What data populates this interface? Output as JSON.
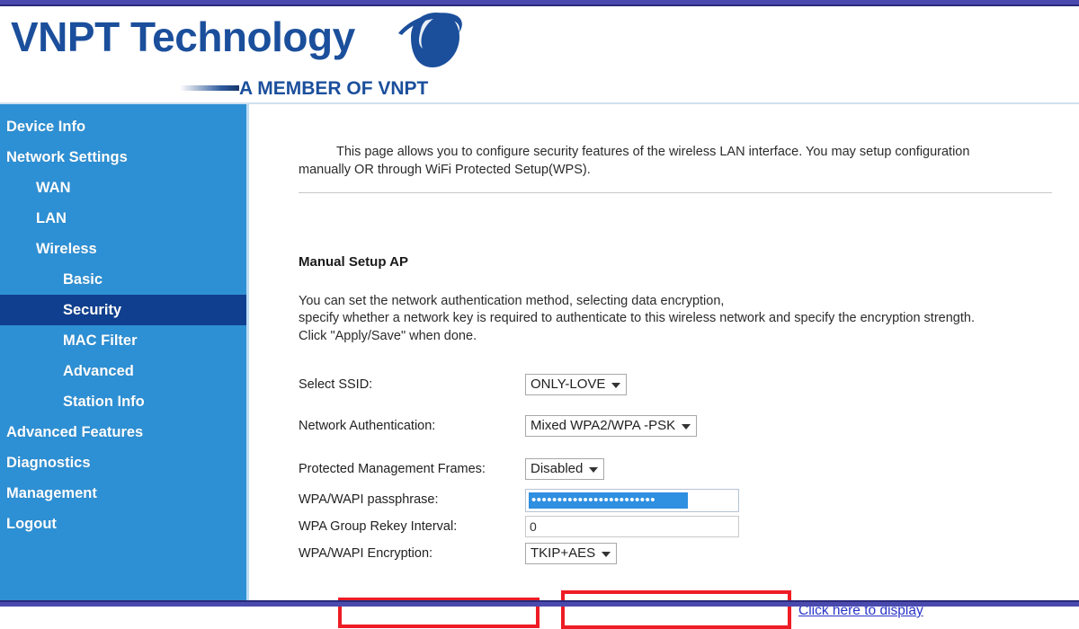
{
  "brand": {
    "title": "VNPT Technology",
    "subtitle": "A MEMBER OF VNPT",
    "logo_icon": "vnpt-globe-swoosh-icon",
    "primary_color": "#1b4f9c",
    "sidebar_color": "#2e90d4",
    "sidebar_active_color": "#103f8f",
    "chrome_bar_color": "#4a4aae",
    "annotation_color": "#ee1c25",
    "link_color": "#2a35c7"
  },
  "sidebar": {
    "items": [
      {
        "label": "Device Info",
        "level": 0,
        "active": false
      },
      {
        "label": "Network Settings",
        "level": 0,
        "active": false
      },
      {
        "label": "WAN",
        "level": 1,
        "active": false
      },
      {
        "label": "LAN",
        "level": 1,
        "active": false
      },
      {
        "label": "Wireless",
        "level": 1,
        "active": false
      },
      {
        "label": "Basic",
        "level": 2,
        "active": false
      },
      {
        "label": "Security",
        "level": 2,
        "active": true
      },
      {
        "label": "MAC Filter",
        "level": 2,
        "active": false
      },
      {
        "label": "Advanced",
        "level": 2,
        "active": false
      },
      {
        "label": "Station Info",
        "level": 2,
        "active": false
      },
      {
        "label": "Advanced Features",
        "level": 0,
        "active": false
      },
      {
        "label": "Diagnostics",
        "level": 0,
        "active": false
      },
      {
        "label": "Management",
        "level": 0,
        "active": false
      },
      {
        "label": "Logout",
        "level": 0,
        "active": false
      }
    ]
  },
  "main": {
    "intro": "This page allows you to configure security features of the wireless LAN interface. You may setup configuration manually OR through WiFi Protected Setup(WPS).",
    "section_title": "Manual Setup AP",
    "section_description": "You can set the network authentication method, selecting data encryption,\nspecify whether a network key is required to authenticate to this wireless network and specify the encryption strength.\nClick \"Apply/Save\" when done.",
    "fields": {
      "select_ssid": {
        "label": "Select SSID:",
        "value": "ONLY-LOVE",
        "options": [
          "ONLY-LOVE"
        ]
      },
      "network_authentication": {
        "label": "Network Authentication:",
        "value": "Mixed WPA2/WPA -PSK",
        "options": [
          "Mixed WPA2/WPA -PSK"
        ]
      },
      "protected_management_frames": {
        "label": "Protected Management Frames:",
        "value": "Disabled",
        "options": [
          "Disabled"
        ]
      },
      "wpa_passphrase": {
        "label": "WPA/WAPI passphrase:",
        "value": "••••••••••••••••••••••••",
        "masked": true,
        "selected": true,
        "reveal_link": "Click here to display"
      },
      "wpa_group_rekey_interval": {
        "label": "WPA Group Rekey Interval:",
        "value": "0"
      },
      "wpa_encryption": {
        "label": "WPA/WAPI Encryption:",
        "value": "TKIP+AES",
        "options": [
          "TKIP+AES"
        ]
      }
    }
  },
  "annotations": {
    "highlight_label": "WPA/WAPI passphrase:",
    "highlight_field": "wpa-passphrase-input"
  }
}
